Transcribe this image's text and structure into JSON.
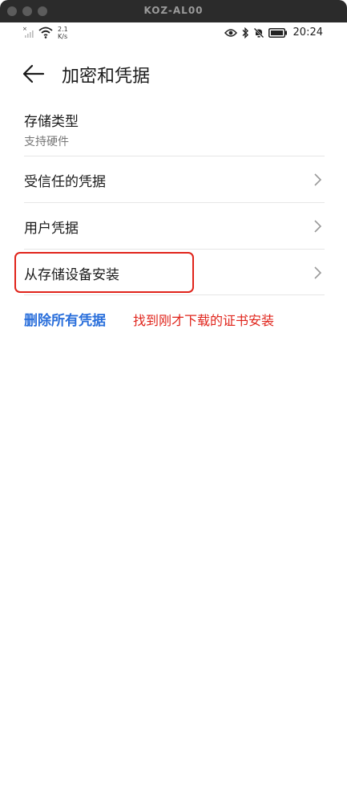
{
  "window": {
    "title": "KOZ-AL00"
  },
  "status_bar": {
    "net_speed_value": "2.1",
    "net_speed_unit": "K/s",
    "time": "20:24",
    "icons": [
      "no-sim-icon",
      "signal-icon",
      "wifi-icon",
      "eye-icon",
      "bluetooth-icon",
      "mute-icon",
      "battery-icon"
    ]
  },
  "header": {
    "title": "加密和凭据",
    "back_icon": "arrow-left-icon"
  },
  "storage": {
    "label": "存储类型",
    "value": "支持硬件"
  },
  "menu": [
    {
      "label": "受信任的凭据",
      "icon": "chevron-right-icon"
    },
    {
      "label": "用户凭据",
      "icon": "chevron-right-icon"
    },
    {
      "label": "从存储设备安装",
      "icon": "chevron-right-icon"
    }
  ],
  "delete_all": {
    "label": "删除所有凭据"
  },
  "annotation": {
    "text": "找到刚才下载的证书安装",
    "color": "#e0241b"
  },
  "colors": {
    "link": "#2a6fdb",
    "highlight": "#e0241b",
    "divider": "#e6e6e6"
  }
}
